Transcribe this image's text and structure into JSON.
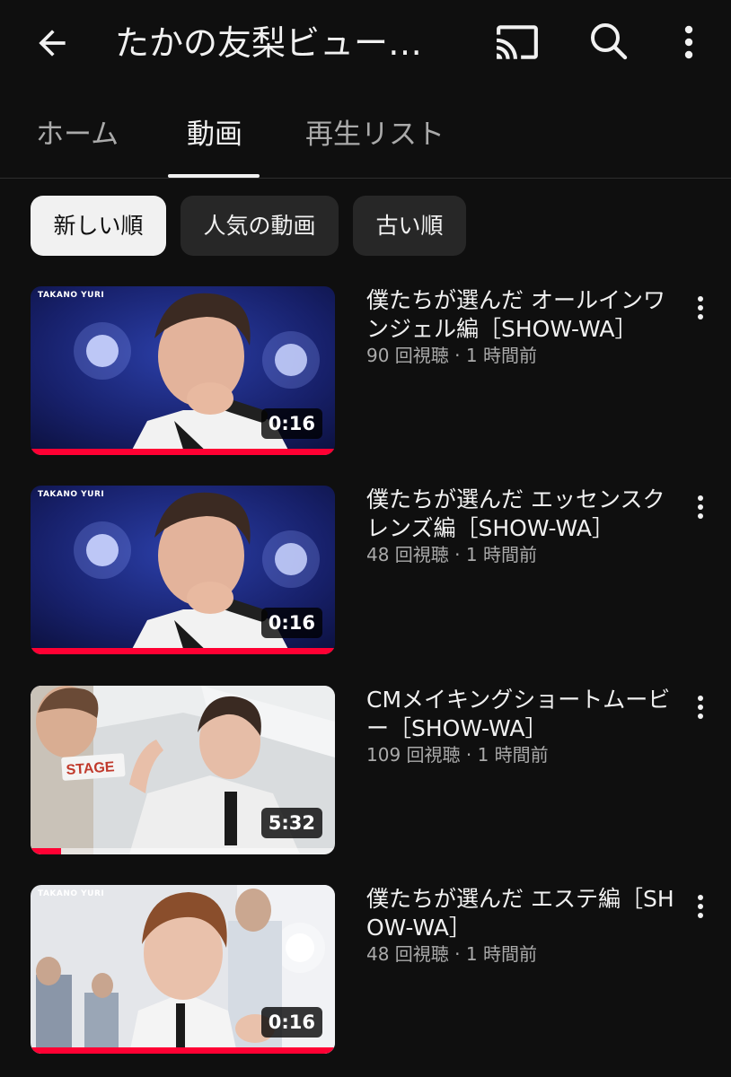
{
  "appbar": {
    "title": "たかの友梨ビュー…",
    "back_icon": "arrow-back-icon",
    "cast_icon": "cast-icon",
    "search_icon": "search-icon",
    "more_icon": "more-vert-icon"
  },
  "tabs": [
    {
      "label": "ホーム",
      "active": false
    },
    {
      "label": "動画",
      "active": true
    },
    {
      "label": "再生リスト",
      "active": false
    }
  ],
  "chips": [
    {
      "label": "新しい順",
      "selected": true
    },
    {
      "label": "人気の動画",
      "selected": false
    },
    {
      "label": "古い順",
      "selected": false
    }
  ],
  "videos": [
    {
      "title": "僕たちが選んだ オールインワンジェル編［SHOW-WA］",
      "meta": "90 回視聴 · 1 時間前",
      "duration": "0:16",
      "thumb_brand": "TAKANO YURI",
      "watched": 1.0
    },
    {
      "title": "僕たちが選んだ エッセンスクレンズ編［SHOW-WA］",
      "meta": "48 回視聴 · 1 時間前",
      "duration": "0:16",
      "thumb_brand": "TAKANO YURI",
      "watched": 1.0
    },
    {
      "title": "CMメイキングショートムービー［SHOW-WA］",
      "meta": "109 回視聴 · 1 時間前",
      "duration": "5:32",
      "thumb_text": "STAGE",
      "watched": 0.1
    },
    {
      "title": "僕たちが選んだ エステ編［SHOW-WA］",
      "meta": "48 回視聴 · 1 時間前",
      "duration": "0:16",
      "thumb_brand": "TAKANO YURI",
      "watched": 1.0
    }
  ],
  "colors": {
    "background": "#0f0f0f",
    "progress": "#ff0033",
    "chip_bg": "#272727",
    "chip_selected_bg": "#f1f1f1",
    "secondary_text": "#aaaaaa"
  }
}
